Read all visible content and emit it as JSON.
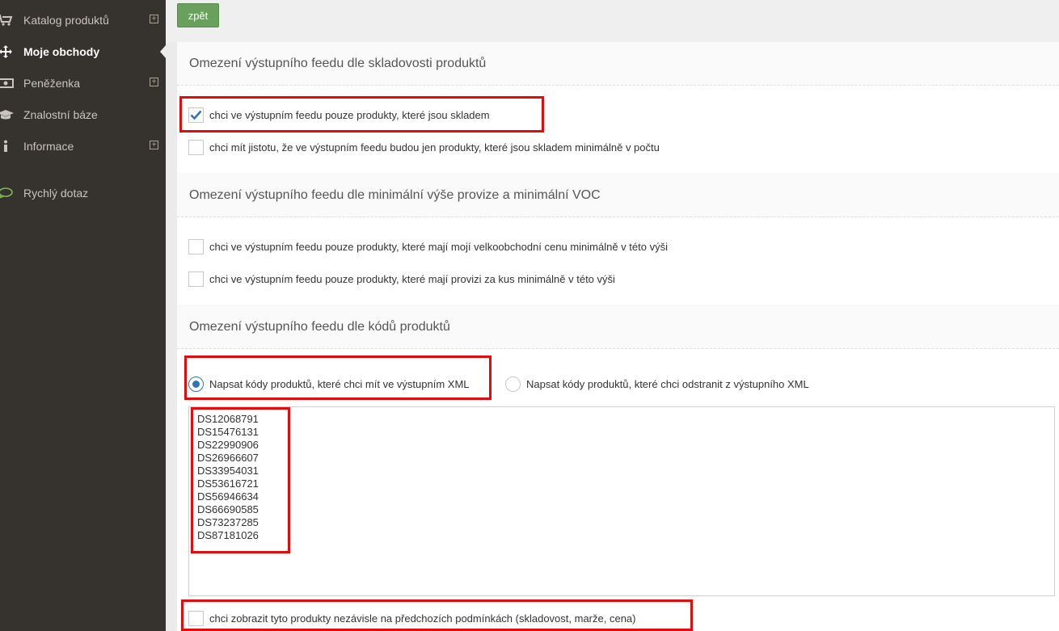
{
  "sidebar": {
    "items": [
      {
        "label": "Katalog produktů",
        "icon": "cart-icon",
        "expandable": true,
        "active": false
      },
      {
        "label": "Moje obchody",
        "icon": "move-arrows-icon",
        "expandable": false,
        "active": true
      },
      {
        "label": "Peněženka",
        "icon": "money-icon",
        "expandable": true,
        "active": false
      },
      {
        "label": "Znalostní báze",
        "icon": "graduation-cap-icon",
        "expandable": false,
        "active": false
      },
      {
        "label": "Informace",
        "icon": "info-icon",
        "expandable": true,
        "active": false
      },
      {
        "label": "Rychlý dotaz",
        "icon": "chat-bubble-icon",
        "expandable": false,
        "active": false
      }
    ]
  },
  "toolbar": {
    "back_label": "zpět"
  },
  "sections": {
    "stock": {
      "title": "Omezení výstupního feedu dle skladovosti produktů",
      "options": [
        {
          "label": "chci ve výstupním feedu pouze produkty, které jsou skladem",
          "checked": true
        },
        {
          "label": "chci mít jistotu, že ve výstupním feedu budou jen produkty, které jsou skladem minimálně v počtu",
          "checked": false
        }
      ]
    },
    "commission": {
      "title": "Omezení výstupního feedu dle minimální výše provize a minimální VOC",
      "options": [
        {
          "label": "chci ve výstupním feedu pouze produkty, které mají mojí velkoobchodní cenu minimálně v této výši",
          "checked": false
        },
        {
          "label": "chci ve výstupním feedu pouze produkty, které mají provizi za kus minimálně v této výši",
          "checked": false
        }
      ]
    },
    "codes": {
      "title": "Omezení výstupního feedu dle kódů produktů",
      "radios": [
        {
          "label": "Napsat kódy produktů, které chci mít ve výstupním XML",
          "selected": true
        },
        {
          "label": "Napsat kódy produktů, které chci odstranit z výstupního XML",
          "selected": false
        }
      ],
      "codes_list": [
        "DS12068791",
        "DS15476131",
        "DS22990906",
        "DS26966607",
        "DS33954031",
        "DS53616721",
        "DS56946634",
        "DS66690585",
        "DS73237285",
        "DS87181026"
      ],
      "independent_option": {
        "label": "chci zobrazit tyto produkty nezávisle na předchozích podmínkách (skladovost, marže, cena)",
        "checked": false
      }
    }
  },
  "colors": {
    "sidebar_bg": "#36322d",
    "accent_green": "#6aa05e",
    "highlight_red": "#e30b0b",
    "check_blue": "#2f74b5"
  }
}
